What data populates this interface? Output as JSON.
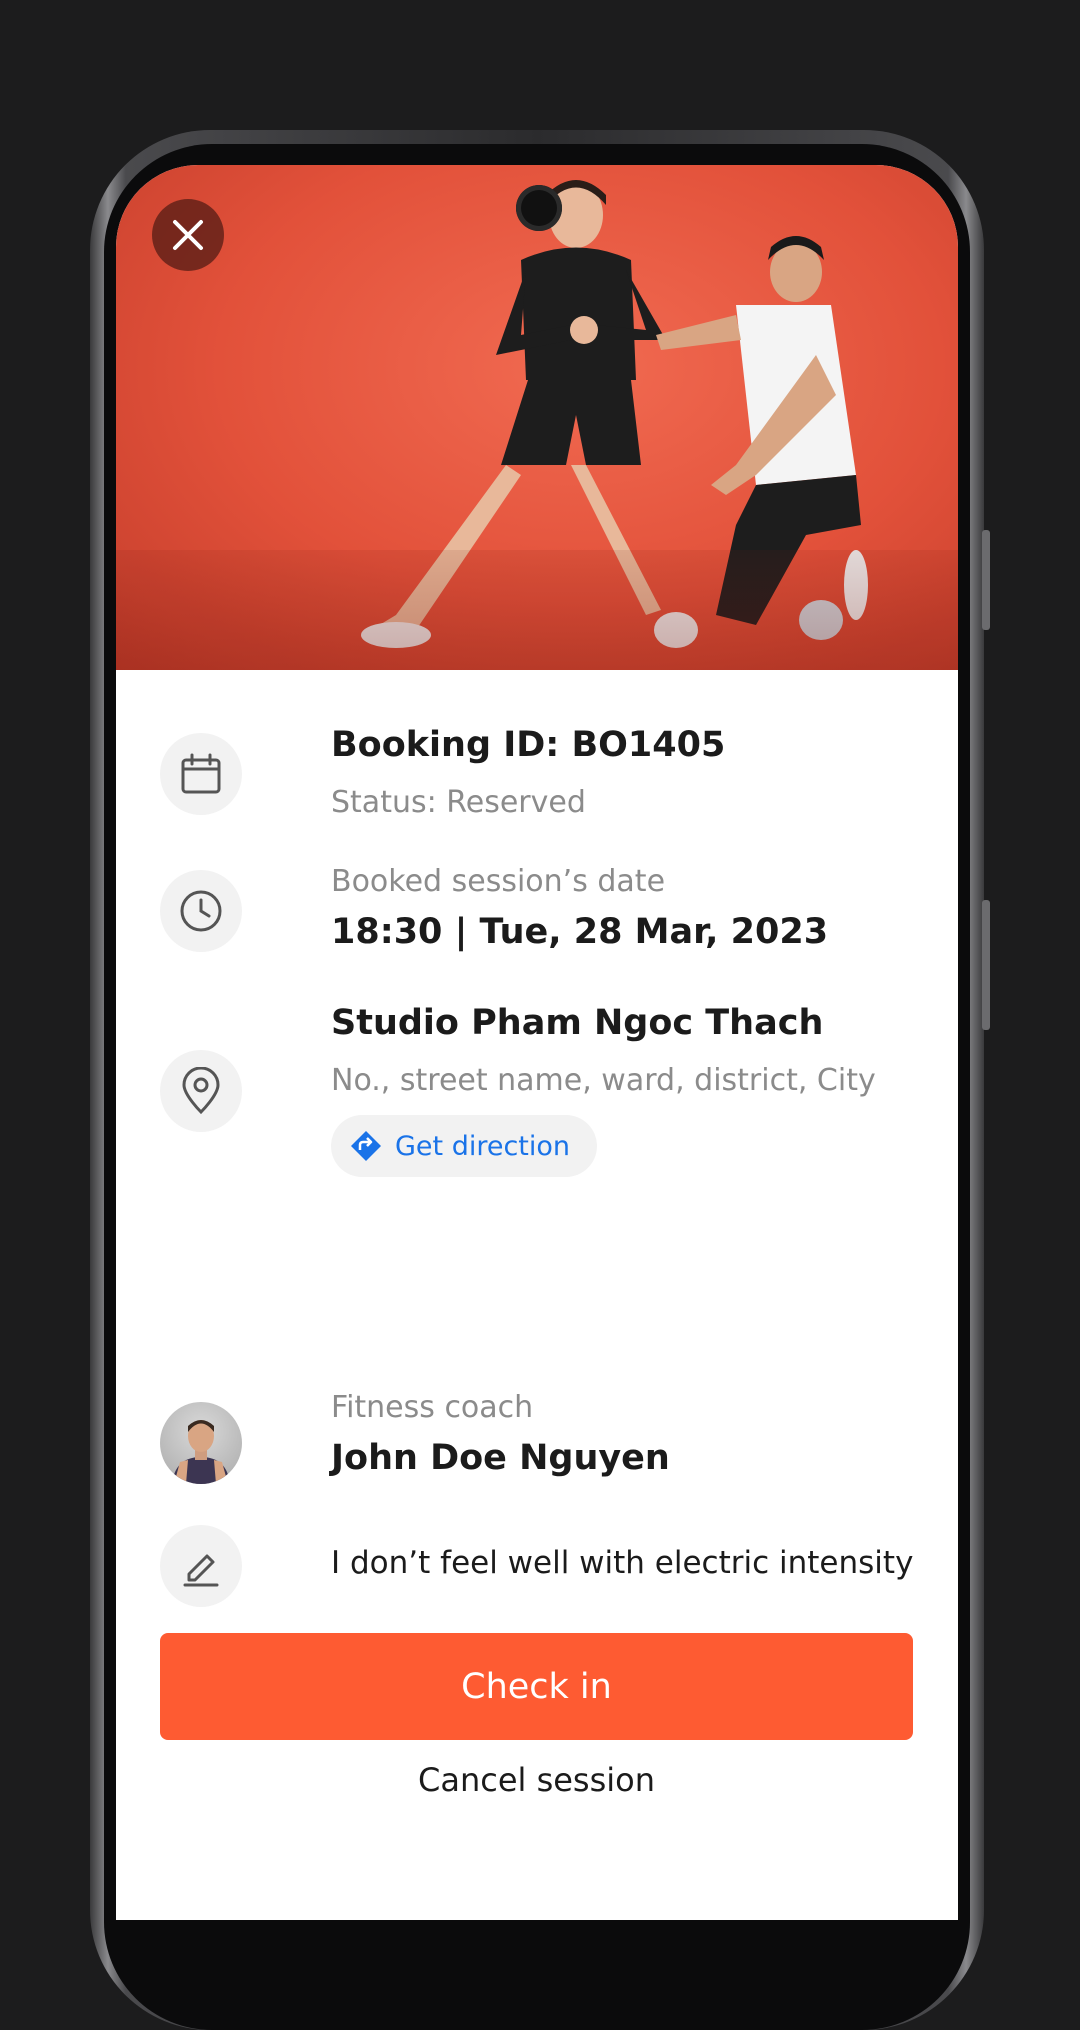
{
  "colors": {
    "background": "#1c1c1d",
    "hero": "#e2513a",
    "primary_button": "#fe5b32",
    "link": "#1a73e8",
    "muted_text": "#8b8b8b",
    "icon_bg": "#f2f2f2"
  },
  "hero": {
    "image": "fitness-training-photo",
    "close_icon": "close-icon"
  },
  "booking": {
    "id_label": "Booking ID: BO1405",
    "status_label": "Status: Reserved",
    "icon": "calendar-icon"
  },
  "session": {
    "date_label": "Booked session’s date",
    "date_value": "18:30 | Tue, 28 Mar, 2023",
    "icon": "clock-icon"
  },
  "studio": {
    "name": "Studio Pham Ngoc Thach",
    "address": "No., street name, ward, district, City",
    "direction_label": "Get direction",
    "icon": "location-pin-icon",
    "direction_icon": "direction-icon"
  },
  "coach": {
    "role_label": "Fitness coach",
    "name": "John Doe Nguyen"
  },
  "note": {
    "text": "I don’t feel well with electric intensity",
    "icon": "edit-icon"
  },
  "actions": {
    "checkin_label": "Check in",
    "cancel_label": "Cancel session"
  }
}
